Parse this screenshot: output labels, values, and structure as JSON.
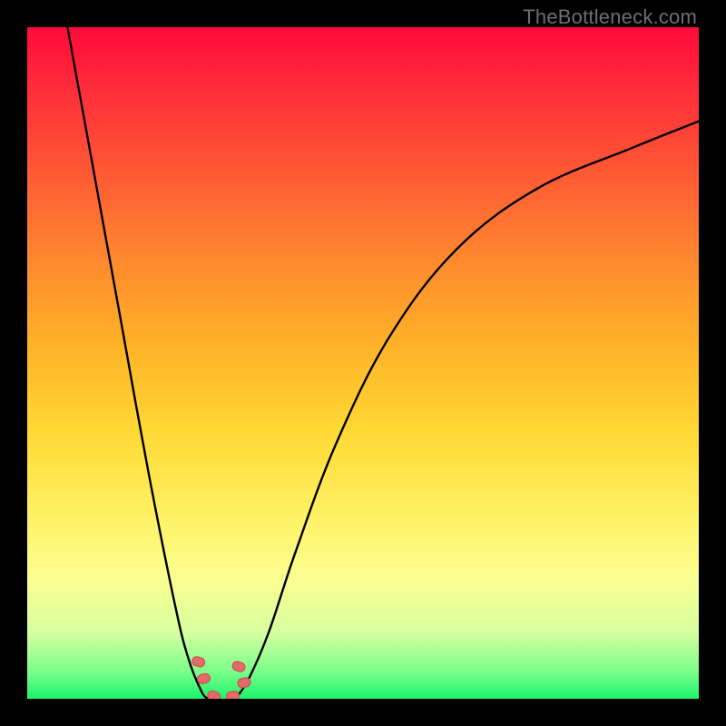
{
  "watermark": "TheBottleneck.com",
  "chart_data": {
    "type": "line",
    "title": "",
    "xlabel": "",
    "ylabel": "",
    "xlim": [
      0,
      100
    ],
    "ylim": [
      0,
      100
    ],
    "notes": "Two V-shaped bottleneck curves on a red→green gradient background. Y encodes bottleneck severity (red=high near top, green=low near bottom). Curves dip to ~0 around x≈26–32 then rise again. Small pink capsule markers sit near the trough.",
    "series": [
      {
        "name": "left-branch",
        "x": [
          6,
          10,
          14,
          18,
          22,
          24,
          26,
          27
        ],
        "values": [
          100,
          78,
          56,
          34,
          14,
          6,
          1,
          0
        ]
      },
      {
        "name": "right-branch",
        "x": [
          31,
          33,
          36,
          40,
          46,
          54,
          64,
          76,
          90,
          100
        ],
        "values": [
          0,
          3,
          10,
          22,
          38,
          54,
          67,
          76,
          82,
          86
        ]
      }
    ],
    "markers": [
      {
        "x": 25.5,
        "y": 5.5
      },
      {
        "x": 26.3,
        "y": 3.0
      },
      {
        "x": 31.5,
        "y": 4.8
      },
      {
        "x": 32.3,
        "y": 2.4
      },
      {
        "x": 27.8,
        "y": 0.4
      },
      {
        "x": 30.6,
        "y": 0.4
      }
    ]
  }
}
